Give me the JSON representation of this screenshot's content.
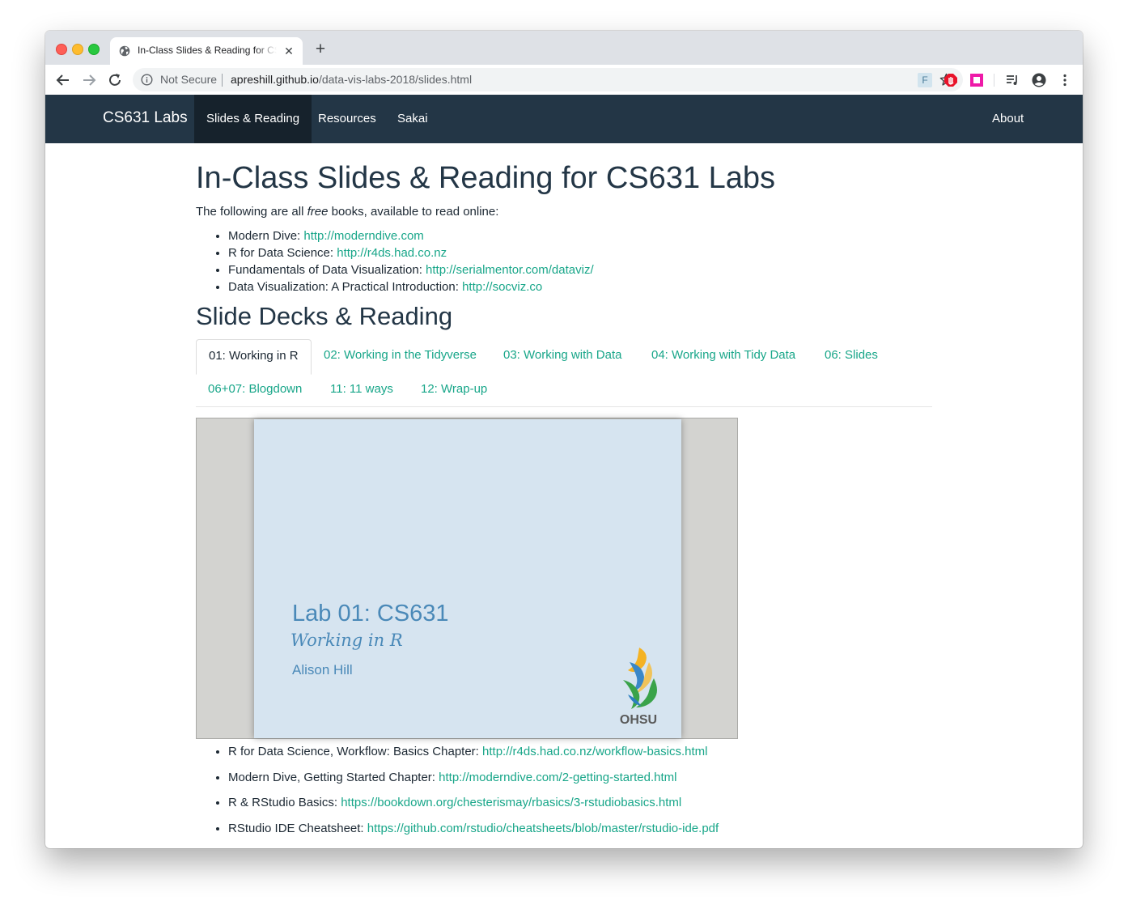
{
  "browser": {
    "tab_title": "In-Class Slides & Reading for CS631 Labs",
    "tab_close": "✕",
    "new_tab": "+",
    "security_label": "Not Secure",
    "url_host": "apreshill.github.io",
    "url_path": "/data-vis-labs-2018/slides.html",
    "extension_f": "F"
  },
  "navbar": {
    "brand": "CS631 Labs",
    "items": [
      "Slides & Reading",
      "Resources",
      "Sakai"
    ],
    "right_item": "About"
  },
  "page": {
    "title": "In-Class Slides & Reading for CS631 Labs",
    "intro_before": "The following are all ",
    "intro_em": "free",
    "intro_after": " books, available to read online:",
    "books": [
      {
        "label": "Modern Dive: ",
        "link": "http://moderndive.com"
      },
      {
        "label": "R for Data Science: ",
        "link": "http://r4ds.had.co.nz"
      },
      {
        "label": "Fundamentals of Data Visualization: ",
        "link": "http://serialmentor.com/dataviz/"
      },
      {
        "label": "Data Visualization: A Practical Introduction: ",
        "link": "http://socviz.co"
      }
    ],
    "section_title": "Slide Decks & Reading",
    "tabs": [
      "01: Working in R",
      "02: Working in the Tidyverse",
      "03: Working with Data",
      "04: Working with Tidy Data",
      "06: Slides",
      "06+07: Blogdown",
      "11: 11 ways",
      "12: Wrap-up"
    ],
    "slide": {
      "title": "Lab 01: CS631",
      "subtitle": "Working in R",
      "author": "Alison Hill",
      "logo_text": "OHSU"
    },
    "reading": [
      {
        "label": "R for Data Science, Workflow: Basics Chapter: ",
        "link": "http://r4ds.had.co.nz/workflow-basics.html"
      },
      {
        "label": "Modern Dive, Getting Started Chapter: ",
        "link": "http://moderndive.com/2-getting-started.html"
      },
      {
        "label": "R & RStudio Basics: ",
        "link": "https://bookdown.org/chesterismay/rbasics/3-rstudiobasics.html"
      },
      {
        "label": "RStudio IDE Cheatsheet: ",
        "link": "https://github.com/rstudio/cheatsheets/blob/master/rstudio-ide.pdf"
      }
    ]
  },
  "colors": {
    "navbar_bg": "#233646",
    "navbar_active_bg": "#16222c",
    "link": "#18a689",
    "heading": "#233646",
    "slide_bg": "#d6e4f0",
    "slide_text": "#4a89b8"
  },
  "icons": [
    "globe-icon",
    "back-arrow-icon",
    "forward-arrow-icon",
    "reload-icon",
    "info-icon",
    "star-icon",
    "stop-hand-icon",
    "square-extension-icon",
    "media-queue-icon",
    "account-icon",
    "more-vert-icon",
    "ohsu-logo"
  ]
}
